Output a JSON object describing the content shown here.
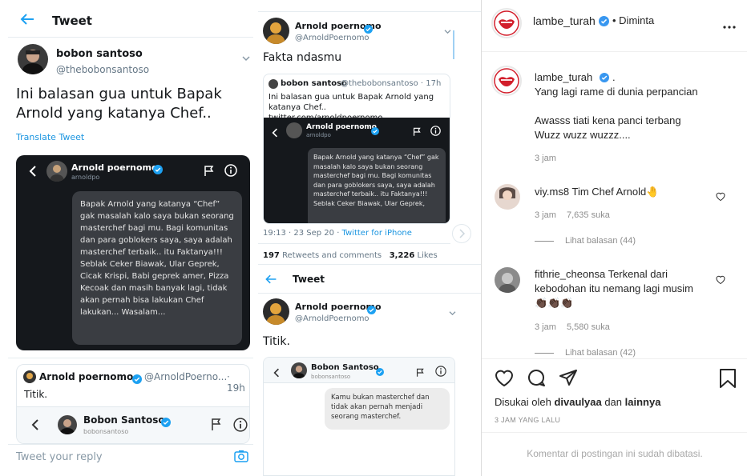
{
  "tweet1": {
    "header": "Tweet",
    "author_name": "bobon santoso",
    "author_handle": "@thebobonsantoso",
    "text": "Ini balasan gua untuk Bapak Arnold yang katanya Chef..",
    "translate": "Translate Tweet",
    "dm": {
      "name": "Arnold poernomo",
      "sub": "arnoldpo",
      "message": "Bapak Arnold yang katanya “Chef” gak masalah kalo saya bukan seorang masterchef bagi mu. Bagi komunitas dan para goblokers saya, saya adalah masterchef terbaik.. itu Faktanya!!! Seblak Ceker Biawak, Ular Geprek, Cicak Krispi, Babi geprek amer, Pizza Kecoak dan masih banyak lagi, tidak akan pernah bisa lakukan Chef lakukan... Wasalam..."
    },
    "reply": {
      "name": "Arnold poernomo",
      "handle": "@ArnoldPoerno...",
      "time": "· 19h",
      "text": "Titik.",
      "dm_name": "Bobon Santoso",
      "dm_sub": "bobonsantoso"
    },
    "reply_placeholder": "Tweet your reply"
  },
  "tweet2": {
    "author_name": "Arnold poernomo",
    "author_handle": "@ArnoldPoernomo",
    "text": "Fakta ndasmu",
    "quote": {
      "name": "bobon santoso",
      "handle": "@thebobonsantoso · 17h",
      "text": "Ini balasan gua untuk Bapak Arnold yang katanya Chef.. twitter.com/arnoldpoernomo...",
      "dm_name": "Arnold poernomo",
      "dm_sub": "arnoldpo",
      "dm_message": "Bapak Arnold yang katanya “Chef” gak masalah kalo saya bukan seorang masterchef bagi mu. Bagi komunitas dan para goblokers saya, saya adalah masterchef terbaik.. itu Faktanya!!! Seblak Ceker Biawak, Ular Geprek,"
    },
    "meta_time": "19:13 · 23 Sep 20 · ",
    "meta_source": "Twitter for iPhone",
    "retweets": "197",
    "retweets_label": "Retweets and comments",
    "likes": "3,226",
    "likes_label": "Likes"
  },
  "tweet3": {
    "header": "Tweet",
    "author_name": "Arnold poernomo",
    "author_handle": "@ArnoldPoernomo",
    "text": "Titik.",
    "dm_name": "Bobon Santoso",
    "dm_sub": "bobonsantoso",
    "dm_message": "Kamu bukan masterchef dan tidak akan pernah menjadi seorang masterchef."
  },
  "instagram": {
    "username": "lambe_turah",
    "status": "• Diminta",
    "caption_user": "lambe_turah",
    "caption_dot": ".",
    "caption_lines": [
      "Yang lagi rame di dunia perpancian",
      "",
      "Awasss tiati kena panci terbang",
      "Wuzz wuzz wuzzz...."
    ],
    "caption_time": "3 jam",
    "comments": [
      {
        "user": "viy.ms8",
        "text": "Tim Chef Arnold🤚",
        "time": "3 jam",
        "likes": "7,635 suka",
        "replies": "Lihat balasan (44)"
      },
      {
        "user": "fithrie_cheonsa",
        "text": "Terkenal dari kebodohan itu nemang lagi musim 👏🏿👏🏿👏🏿",
        "time": "3 jam",
        "likes": "5,580 suka",
        "replies": "Lihat balasan (42)"
      }
    ],
    "liked_by_prefix": "Disukai oleh ",
    "liked_by_user": "divaulyaa",
    "liked_by_mid": " dan ",
    "liked_by_others": "lainnya",
    "post_time": "3 JAM YANG LALU",
    "comments_limited": "Komentar di postingan ini sudah dibatasi."
  }
}
